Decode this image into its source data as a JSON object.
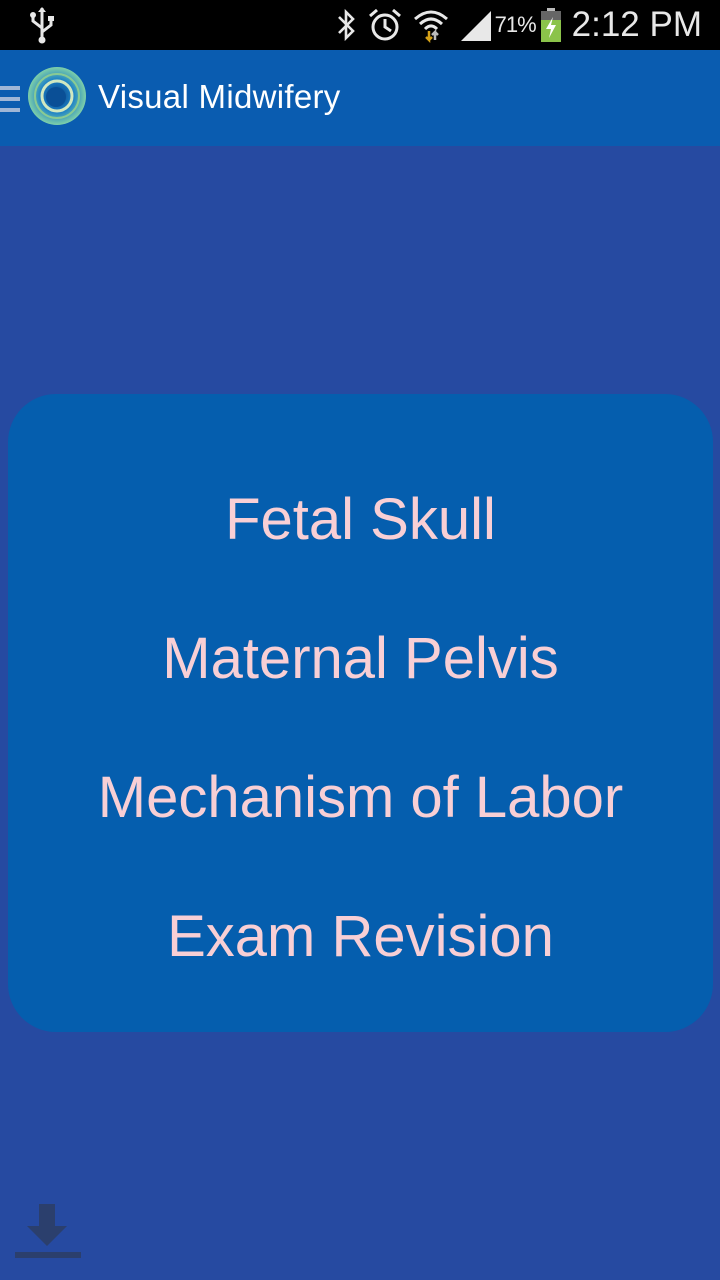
{
  "status_bar": {
    "battery_percent": "71%",
    "time": "2:12 PM",
    "icons": [
      "usb-icon",
      "bluetooth-icon",
      "alarm-icon",
      "wifi-icon",
      "signal-icon",
      "battery-charging-icon"
    ]
  },
  "action_bar": {
    "title": "Visual Midwifery",
    "icons": [
      "menu-icon",
      "app-logo-icon"
    ]
  },
  "menu": {
    "items": [
      {
        "label": "Fetal Skull"
      },
      {
        "label": "Maternal Pelvis"
      },
      {
        "label": "Mechanism of Labor"
      },
      {
        "label": "Exam Revision"
      }
    ]
  },
  "footer": {
    "icons": [
      "download-icon"
    ]
  },
  "colors": {
    "background": "#264aa1",
    "action_bar": "#0a5cb0",
    "card": "#055eae",
    "menu_text": "#f8cfd5"
  }
}
